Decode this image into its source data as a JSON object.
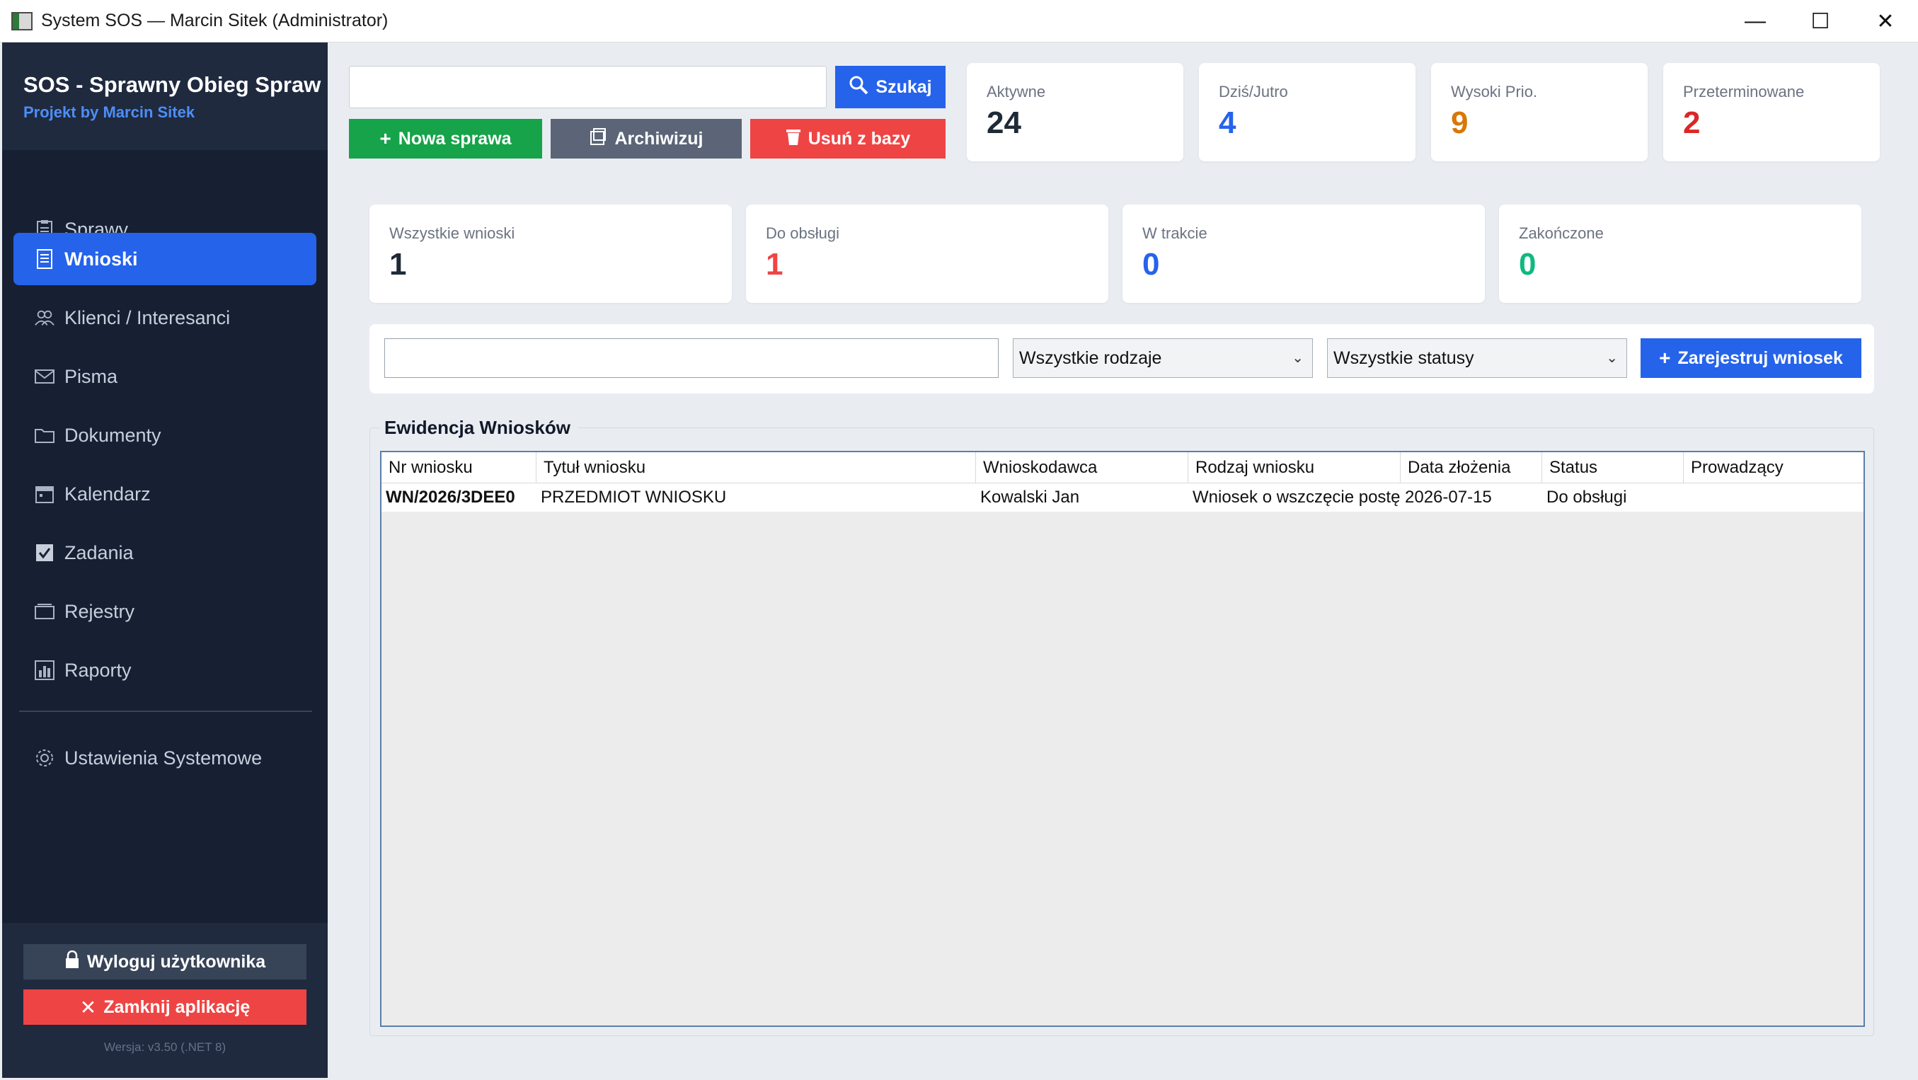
{
  "window": {
    "title": "System SOS — Marcin Sitek (Administrator)",
    "minimize": "—",
    "maximize": "☐",
    "close": "✕"
  },
  "sidebar": {
    "app_name": "SOS - Sprawny Obieg Spraw",
    "subtitle": "Projekt by Marcin Sitek",
    "items": [
      {
        "label": "Sprawy",
        "icon": "clipboard-icon"
      },
      {
        "label": "Wnioski",
        "icon": "document-icon",
        "active": true
      },
      {
        "label": "Klienci / Interesanci",
        "icon": "users-icon"
      },
      {
        "label": "Pisma",
        "icon": "envelope-icon"
      },
      {
        "label": "Dokumenty",
        "icon": "folder-icon"
      },
      {
        "label": "Kalendarz",
        "icon": "calendar-icon"
      },
      {
        "label": "Zadania",
        "icon": "checkbox-icon"
      },
      {
        "label": "Rejestry",
        "icon": "register-icon"
      },
      {
        "label": "Raporty",
        "icon": "bar-chart-icon"
      }
    ],
    "settings_label": "Ustawienia Systemowe",
    "logout_label": "Wyloguj użytkownika",
    "close_label": "Zamknij aplikację",
    "version": "Wersja: v3.50 (.NET 8)"
  },
  "toolbar": {
    "search_value": "",
    "search_label": "Szukaj",
    "new_label": "Nowa sprawa",
    "archive_label": "Archiwizuj",
    "delete_label": "Usuń z bazy"
  },
  "top_stats": [
    {
      "label": "Aktywne",
      "value": "24",
      "color": "#1f2937"
    },
    {
      "label": "Dziś/Jutro",
      "value": "4",
      "color": "#2563eb"
    },
    {
      "label": "Wysoki Prio.",
      "value": "9",
      "color": "#d97706"
    },
    {
      "label": "Przeterminowane",
      "value": "2",
      "color": "#dc2626"
    }
  ],
  "request_stats": [
    {
      "label": "Wszystkie wnioski",
      "value": "1",
      "color": "#1f2937"
    },
    {
      "label": "Do obsługi",
      "value": "1",
      "color": "#ef4444"
    },
    {
      "label": "W trakcie",
      "value": "0",
      "color": "#2563eb"
    },
    {
      "label": "Zakończone",
      "value": "0",
      "color": "#10b981"
    }
  ],
  "filters": {
    "text_value": "",
    "type_selected": "Wszystkie rodzaje",
    "status_selected": "Wszystkie statusy",
    "register_label": "Zarejestruj wniosek"
  },
  "table": {
    "title": "Ewidencja Wniosków",
    "columns": [
      "Nr wniosku",
      "Tytuł wniosku",
      "Wnioskodawca",
      "Rodzaj wniosku",
      "Data złożenia",
      "Status",
      "Prowadzący"
    ],
    "rows": [
      [
        "WN/2026/3DEE0",
        "PRZEDMIOT WNIOSKU",
        "Kowalski Jan",
        "Wniosek o wszczęcie postę",
        "2026-07-15",
        "Do obsługi",
        ""
      ]
    ]
  }
}
